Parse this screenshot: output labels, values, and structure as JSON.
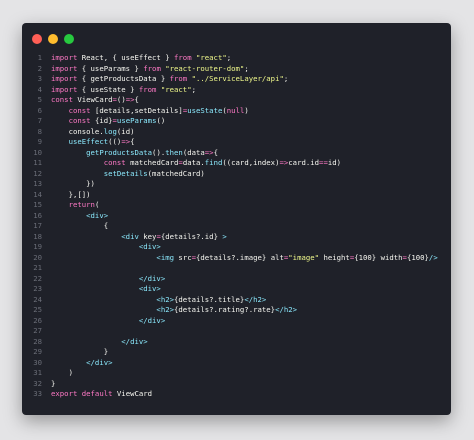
{
  "window": {
    "controls": [
      "close-dot",
      "minimize-dot",
      "maximize-dot"
    ],
    "colors": {
      "close": "#ff5f56",
      "minimize": "#ffbd2e",
      "maximize": "#27c93f",
      "background": "#1f2129"
    }
  },
  "editor": {
    "language": "jsx",
    "lines": [
      {
        "n": "1",
        "tokens": [
          {
            "t": "kw",
            "v": "import"
          },
          {
            "t": "var",
            "v": " React, { useEffect } "
          },
          {
            "t": "kw",
            "v": "from"
          },
          {
            "t": "str",
            "v": " \"react\""
          },
          {
            "t": "punc",
            "v": ";"
          }
        ]
      },
      {
        "n": "2",
        "tokens": [
          {
            "t": "kw",
            "v": "import"
          },
          {
            "t": "var",
            "v": " { useParams } "
          },
          {
            "t": "kw",
            "v": "from"
          },
          {
            "t": "str",
            "v": " \"react-router-dom\""
          },
          {
            "t": "punc",
            "v": ";"
          }
        ]
      },
      {
        "n": "3",
        "tokens": [
          {
            "t": "kw",
            "v": "import"
          },
          {
            "t": "var",
            "v": " { getProductsData } "
          },
          {
            "t": "kw",
            "v": "from"
          },
          {
            "t": "str",
            "v": " \"../ServiceLayer/api\""
          },
          {
            "t": "punc",
            "v": ";"
          }
        ]
      },
      {
        "n": "4",
        "tokens": [
          {
            "t": "kw",
            "v": "import"
          },
          {
            "t": "var",
            "v": " { useState } "
          },
          {
            "t": "kw",
            "v": "from"
          },
          {
            "t": "str",
            "v": " \"react\""
          },
          {
            "t": "punc",
            "v": ";"
          }
        ]
      },
      {
        "n": "5",
        "tokens": [
          {
            "t": "kw",
            "v": "const"
          },
          {
            "t": "var",
            "v": " ViewCard"
          },
          {
            "t": "op",
            "v": "="
          },
          {
            "t": "punc",
            "v": "()"
          },
          {
            "t": "op",
            "v": "=>"
          },
          {
            "t": "punc",
            "v": "{"
          }
        ]
      },
      {
        "n": "6",
        "tokens": [
          {
            "t": "kw",
            "v": "    const"
          },
          {
            "t": "var",
            "v": " [details,setDetails]"
          },
          {
            "t": "op",
            "v": "="
          },
          {
            "t": "fn",
            "v": "useState"
          },
          {
            "t": "punc",
            "v": "("
          },
          {
            "t": "kw",
            "v": "null"
          },
          {
            "t": "punc",
            "v": ")"
          }
        ]
      },
      {
        "n": "7",
        "tokens": [
          {
            "t": "kw",
            "v": "    const"
          },
          {
            "t": "var",
            "v": " {id}"
          },
          {
            "t": "op",
            "v": "="
          },
          {
            "t": "fn",
            "v": "useParams"
          },
          {
            "t": "punc",
            "v": "()"
          }
        ]
      },
      {
        "n": "8",
        "tokens": [
          {
            "t": "var",
            "v": "    console."
          },
          {
            "t": "fn",
            "v": "log"
          },
          {
            "t": "punc",
            "v": "(id)"
          }
        ]
      },
      {
        "n": "9",
        "tokens": [
          {
            "t": "fn",
            "v": "    useEffect"
          },
          {
            "t": "punc",
            "v": "(()"
          },
          {
            "t": "op",
            "v": "=>"
          },
          {
            "t": "punc",
            "v": "{"
          }
        ]
      },
      {
        "n": "10",
        "tokens": [
          {
            "t": "fn",
            "v": "        getProductsData"
          },
          {
            "t": "punc",
            "v": "()."
          },
          {
            "t": "fn",
            "v": "then"
          },
          {
            "t": "punc",
            "v": "(data"
          },
          {
            "t": "op",
            "v": "=>"
          },
          {
            "t": "punc",
            "v": "{"
          }
        ]
      },
      {
        "n": "11",
        "tokens": [
          {
            "t": "kw",
            "v": "            const"
          },
          {
            "t": "var",
            "v": " matchedCard"
          },
          {
            "t": "op",
            "v": "="
          },
          {
            "t": "var",
            "v": "data."
          },
          {
            "t": "fn",
            "v": "find"
          },
          {
            "t": "punc",
            "v": "((card,index)"
          },
          {
            "t": "op",
            "v": "=>"
          },
          {
            "t": "var",
            "v": "card.id"
          },
          {
            "t": "op",
            "v": "=="
          },
          {
            "t": "var",
            "v": "id)"
          }
        ]
      },
      {
        "n": "12",
        "tokens": [
          {
            "t": "fn",
            "v": "            setDetails"
          },
          {
            "t": "punc",
            "v": "(matchedCard)"
          }
        ]
      },
      {
        "n": "13",
        "tokens": [
          {
            "t": "punc",
            "v": "        })"
          }
        ]
      },
      {
        "n": "14",
        "tokens": [
          {
            "t": "punc",
            "v": "    },[])"
          }
        ]
      },
      {
        "n": "15",
        "tokens": [
          {
            "t": "kw",
            "v": "    return"
          },
          {
            "t": "punc",
            "v": "("
          }
        ]
      },
      {
        "n": "16",
        "tokens": [
          {
            "t": "tag",
            "v": "        <div>"
          }
        ]
      },
      {
        "n": "17",
        "tokens": [
          {
            "t": "punc",
            "v": "            {"
          }
        ]
      },
      {
        "n": "18",
        "tokens": [
          {
            "t": "tag",
            "v": "                <div"
          },
          {
            "t": "var",
            "v": " key"
          },
          {
            "t": "op",
            "v": "="
          },
          {
            "t": "punc",
            "v": "{details?.id} "
          },
          {
            "t": "tag",
            "v": ">"
          }
        ]
      },
      {
        "n": "19",
        "tokens": [
          {
            "t": "tag",
            "v": "                    <div>"
          }
        ]
      },
      {
        "n": "20",
        "tokens": [
          {
            "t": "tag",
            "v": "                        <img"
          },
          {
            "t": "var",
            "v": " src"
          },
          {
            "t": "op",
            "v": "="
          },
          {
            "t": "punc",
            "v": "{details?.image}"
          },
          {
            "t": "var",
            "v": " alt"
          },
          {
            "t": "op",
            "v": "="
          },
          {
            "t": "str",
            "v": "\"image\""
          },
          {
            "t": "var",
            "v": " height"
          },
          {
            "t": "op",
            "v": "="
          },
          {
            "t": "punc",
            "v": "{100}"
          },
          {
            "t": "var",
            "v": " width"
          },
          {
            "t": "op",
            "v": "="
          },
          {
            "t": "punc",
            "v": "{100}"
          },
          {
            "t": "tag",
            "v": "/>"
          }
        ]
      },
      {
        "n": "21",
        "tokens": []
      },
      {
        "n": "22",
        "tokens": [
          {
            "t": "tag",
            "v": "                    </div>"
          }
        ]
      },
      {
        "n": "23",
        "tokens": [
          {
            "t": "tag",
            "v": "                    <div>"
          }
        ]
      },
      {
        "n": "24",
        "tokens": [
          {
            "t": "tag",
            "v": "                        <h2>"
          },
          {
            "t": "punc",
            "v": "{details?.title}"
          },
          {
            "t": "tag",
            "v": "</h2>"
          }
        ]
      },
      {
        "n": "25",
        "tokens": [
          {
            "t": "tag",
            "v": "                        <h2>"
          },
          {
            "t": "punc",
            "v": "{details?.rating?.rate}"
          },
          {
            "t": "tag",
            "v": "</h2>"
          }
        ]
      },
      {
        "n": "26",
        "tokens": [
          {
            "t": "tag",
            "v": "                    </div>"
          }
        ]
      },
      {
        "n": "27",
        "tokens": []
      },
      {
        "n": "28",
        "tokens": [
          {
            "t": "tag",
            "v": "                </div>"
          }
        ]
      },
      {
        "n": "29",
        "tokens": [
          {
            "t": "punc",
            "v": "            }"
          }
        ]
      },
      {
        "n": "30",
        "tokens": [
          {
            "t": "tag",
            "v": "        </div>"
          }
        ]
      },
      {
        "n": "31",
        "tokens": [
          {
            "t": "punc",
            "v": "    )"
          }
        ]
      },
      {
        "n": "32",
        "tokens": [
          {
            "t": "punc",
            "v": "}"
          }
        ]
      },
      {
        "n": "33",
        "tokens": [
          {
            "t": "kw",
            "v": "export"
          },
          {
            "t": "kw",
            "v": " default"
          },
          {
            "t": "var",
            "v": " ViewCard"
          }
        ]
      }
    ]
  }
}
